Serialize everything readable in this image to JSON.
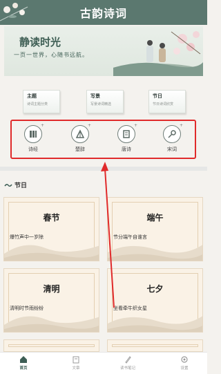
{
  "header": {
    "title": "古韵诗词"
  },
  "banner": {
    "title": "静读时光",
    "subtitle": "一页一世界，心随书远航。"
  },
  "categories": [
    {
      "title": "主题",
      "desc": "诗词主题分类"
    },
    {
      "title": "写景",
      "desc": "写景诗词精选"
    },
    {
      "title": "节日",
      "desc": "节日诗词欣赏"
    }
  ],
  "genres": [
    {
      "label": "诗经",
      "icon": "book-bars-icon"
    },
    {
      "label": "楚辞",
      "icon": "fan-icon"
    },
    {
      "label": "唐诗",
      "icon": "scroll-icon"
    },
    {
      "label": "宋词",
      "icon": "brush-icon"
    }
  ],
  "section": {
    "title": "节日"
  },
  "festivals": [
    {
      "name": "春节",
      "verse": "爆竹声中一岁除"
    },
    {
      "name": "端午",
      "verse": "节分端午自谁言"
    },
    {
      "name": "清明",
      "verse": "清明时节雨纷纷"
    },
    {
      "name": "七夕",
      "verse": "坐看牵牛织女星"
    }
  ],
  "nav": [
    {
      "label": "首页",
      "icon": "home-icon",
      "active": true
    },
    {
      "label": "文章",
      "icon": "book-icon",
      "active": false
    },
    {
      "label": "读书笔记",
      "icon": "pen-icon",
      "active": false
    },
    {
      "label": "设置",
      "icon": "gear-icon",
      "active": false
    }
  ],
  "colors": {
    "header": "#5b786f",
    "accent": "#3d5e55",
    "highlight_box": "#e02a2a",
    "card_bg": "#faf2e6"
  }
}
